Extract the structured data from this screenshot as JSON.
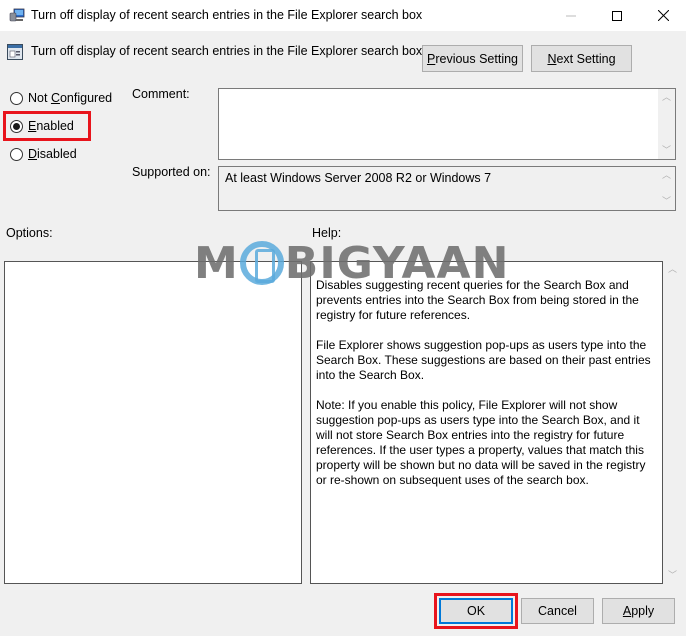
{
  "window": {
    "title": "Turn off display of recent search entries in the File Explorer search box",
    "title_icon": "policy-computer-icon",
    "controls": {
      "minimize": "—",
      "maximize": "☐",
      "close": "✕"
    }
  },
  "header": {
    "title": "Turn off display of recent search entries in the File Explorer search box",
    "icon": "policy-setting-icon",
    "previous_button": {
      "accel": "P",
      "rest": "revious Setting"
    },
    "next_button": {
      "accel": "N",
      "rest": "ext Setting"
    }
  },
  "state_options": [
    {
      "label_prefix": "Not ",
      "accel": "C",
      "label_rest": "onfigured",
      "selected": false
    },
    {
      "label_prefix": "",
      "accel": "E",
      "label_rest": "nabled",
      "selected": true
    },
    {
      "label_prefix": "",
      "accel": "D",
      "label_rest": "isabled",
      "selected": false
    }
  ],
  "comment": {
    "label": "Comment:",
    "value": ""
  },
  "supported_on": {
    "label": "Supported on:",
    "value": "At least Windows Server 2008 R2 or Windows 7"
  },
  "options": {
    "label": "Options:"
  },
  "help": {
    "label": "Help:",
    "paragraphs": [
      "Disables suggesting recent queries for the Search Box and prevents entries into the Search Box from being stored in the registry for future references.",
      "File Explorer shows suggestion pop-ups as users type into the Search Box.  These suggestions are based on their past entries into the Search Box.",
      "Note: If you enable this policy, File Explorer will not show suggestion pop-ups as users type into the Search Box, and it will not store Search Box entries into the registry for future references.  If the user types a property, values that match this property will be shown but no data will be saved in the registry or re-shown on subsequent uses of the search box."
    ]
  },
  "footer": {
    "ok_label": "OK",
    "cancel_label": "Cancel",
    "apply_button": {
      "accel": "A",
      "rest": "pply"
    }
  },
  "watermark": {
    "left": "M",
    "right": "BIGYAAN"
  },
  "colors": {
    "highlight": "#e8141c",
    "focus": "#0078d7",
    "background": "#f0f0f0"
  }
}
